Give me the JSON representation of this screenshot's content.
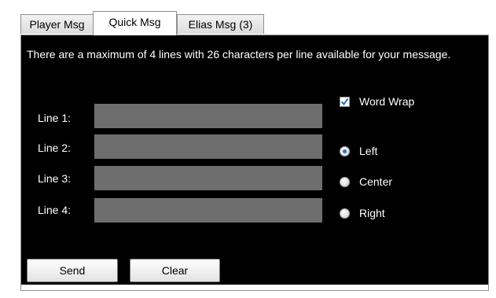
{
  "tabs": [
    {
      "label": "Player Msg",
      "active": false
    },
    {
      "label": "Quick Msg",
      "active": true
    },
    {
      "label": "Elias Msg (3)",
      "active": false
    }
  ],
  "info_text": "There are a maximum of 4 lines with 26 characters per line available for your message.",
  "lines": [
    {
      "label": "Line 1:",
      "value": ""
    },
    {
      "label": "Line 2:",
      "value": ""
    },
    {
      "label": "Line 3:",
      "value": ""
    },
    {
      "label": "Line 4:",
      "value": ""
    }
  ],
  "word_wrap": {
    "label": "Word Wrap",
    "checked": true
  },
  "alignment": {
    "selected": "Left",
    "options": [
      "Left",
      "Center",
      "Right"
    ]
  },
  "buttons": {
    "send_label": "Send",
    "clear_label": "Clear"
  },
  "colors": {
    "panel_background": "#000000",
    "input_background": "#6e6e6e",
    "text": "#ffffff",
    "check_accent": "#2a6fbf"
  },
  "icons": {
    "checkbox_checked": "check-icon",
    "radio_selected": "radio-dot-icon"
  }
}
